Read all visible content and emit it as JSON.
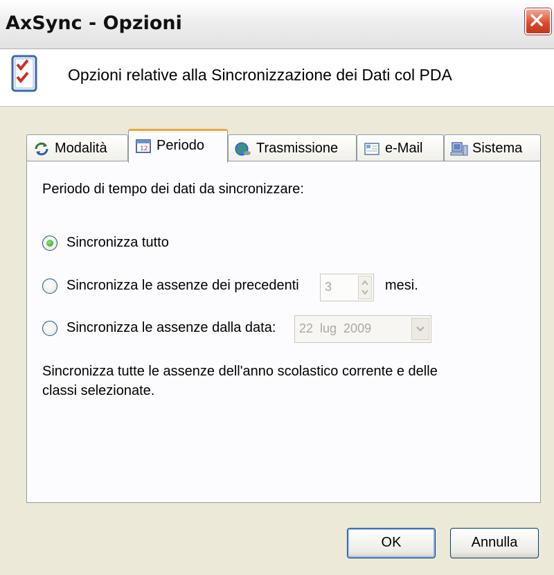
{
  "window": {
    "title": "AxSync - Opzioni"
  },
  "header": {
    "text": "Opzioni relative alla Sincronizzazione dei Dati col PDA"
  },
  "tabs": [
    {
      "label": "Modalità",
      "icon": "sync-arrows-icon"
    },
    {
      "label": "Periodo",
      "icon": "calendar-icon",
      "active": true
    },
    {
      "label": "Trasmissione",
      "icon": "globe-icon"
    },
    {
      "label": "e-Mail",
      "icon": "envelope-icon"
    },
    {
      "label": "Sistema",
      "icon": "computer-icon"
    }
  ],
  "periodo": {
    "prompt": "Periodo di tempo dei dati da sincronizzare:",
    "options": [
      {
        "label": "Sincronizza tutto",
        "selected": true
      },
      {
        "label": "Sincronizza le assenze dei precedenti",
        "selected": false
      },
      {
        "label": "Sincronizza le assenze dalla data:",
        "selected": false
      }
    ],
    "months_value": "3",
    "months_unit": "mesi.",
    "date_value": "22  lug  2009",
    "description": "Sincronizza tutte le assenze dell'anno scolastico corrente e delle classi selezionate."
  },
  "buttons": {
    "ok": "OK",
    "cancel": "Annulla"
  },
  "colors": {
    "active_tab_accent": "#f7a43a",
    "close_button": "#d9472a",
    "radio_checked": "#21a121"
  }
}
